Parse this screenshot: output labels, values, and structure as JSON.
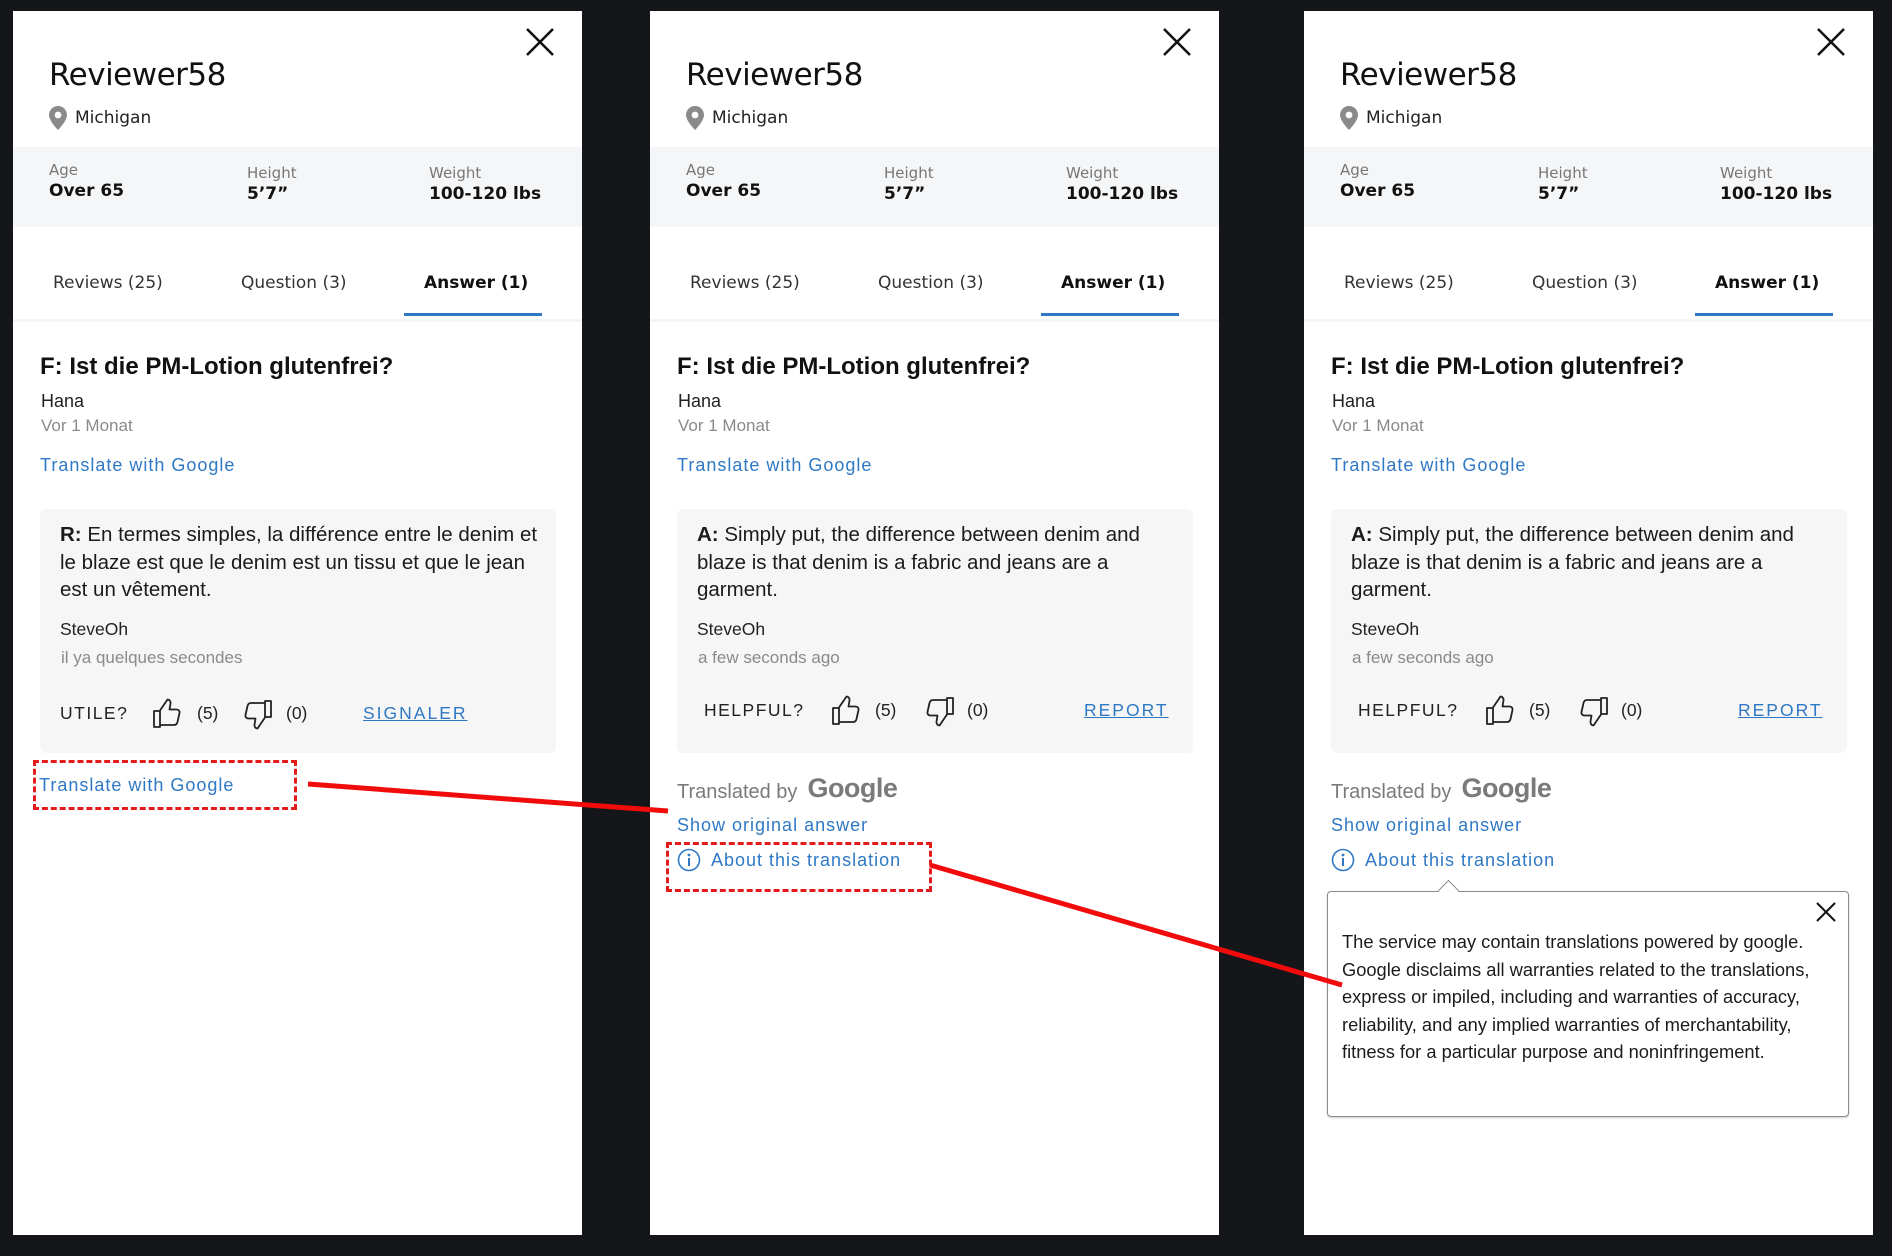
{
  "profile": {
    "name": "Reviewer58",
    "location": "Michigan",
    "stats": [
      {
        "label": "Age",
        "value": "Over 65"
      },
      {
        "label": "Height",
        "value": "5’7”"
      },
      {
        "label": "Weight",
        "value": "100-120 lbs"
      }
    ]
  },
  "tabs": [
    {
      "label": "Reviews (25)",
      "active": false
    },
    {
      "label": "Question (3)",
      "active": false
    },
    {
      "label": "Answer (1)",
      "active": true
    }
  ],
  "question": {
    "title": "F: Ist die PM-Lotion glutenfrei?",
    "author": "Hana",
    "time": "Vor 1 Monat",
    "translate_link": "Translate with Google"
  },
  "panels": [
    {
      "answer_prefix": "R:",
      "answer_text": " En termes simples, la différence entre le denim et le blaze est que le denim est un tissu et que le jean est un vêtement.",
      "author": "SteveOh",
      "time": "il ya quelques secondes",
      "helpful_label": "UTILE?",
      "up_count": "(5)",
      "down_count": "(0)",
      "report_label": "SIGNALER",
      "translate_link": "Translate with Google"
    },
    {
      "answer_prefix": "A:",
      "answer_text": " Simply put, the difference between denim and blaze is that denim is a fabric and jeans are a garment.",
      "author": "SteveOh",
      "time": "a few seconds ago",
      "helpful_label": "HELPFUL?",
      "up_count": "(5)",
      "down_count": "(0)",
      "report_label": "REPORT",
      "translated_by": "Translated by",
      "google_logo": "Google",
      "show_original": "Show original answer",
      "about_translation": "About this translation"
    },
    {
      "answer_prefix": "A:",
      "answer_text": " Simply put, the difference between denim and blaze is that denim is a fabric and jeans are a garment.",
      "author": "SteveOh",
      "time": "a few seconds ago",
      "helpful_label": "HELPFUL?",
      "up_count": "(5)",
      "down_count": "(0)",
      "report_label": "REPORT",
      "translated_by": "Translated by",
      "google_logo": "Google",
      "show_original": "Show original answer",
      "about_translation": "About this translation",
      "popup_text": "The service may contain translations powered by google. Google disclaims all warranties related to the translations, express or impiled, including and warranties of accuracy, reliability, and any implied warranties of merchantability, fitness for a particular purpose and noninfringement."
    }
  ],
  "colors": {
    "link": "#2f78c4",
    "annotation": "#e41b1b",
    "stats_bg": "#f5f6f8",
    "card_bg": "#f6f6f6",
    "backdrop": "#151619"
  }
}
